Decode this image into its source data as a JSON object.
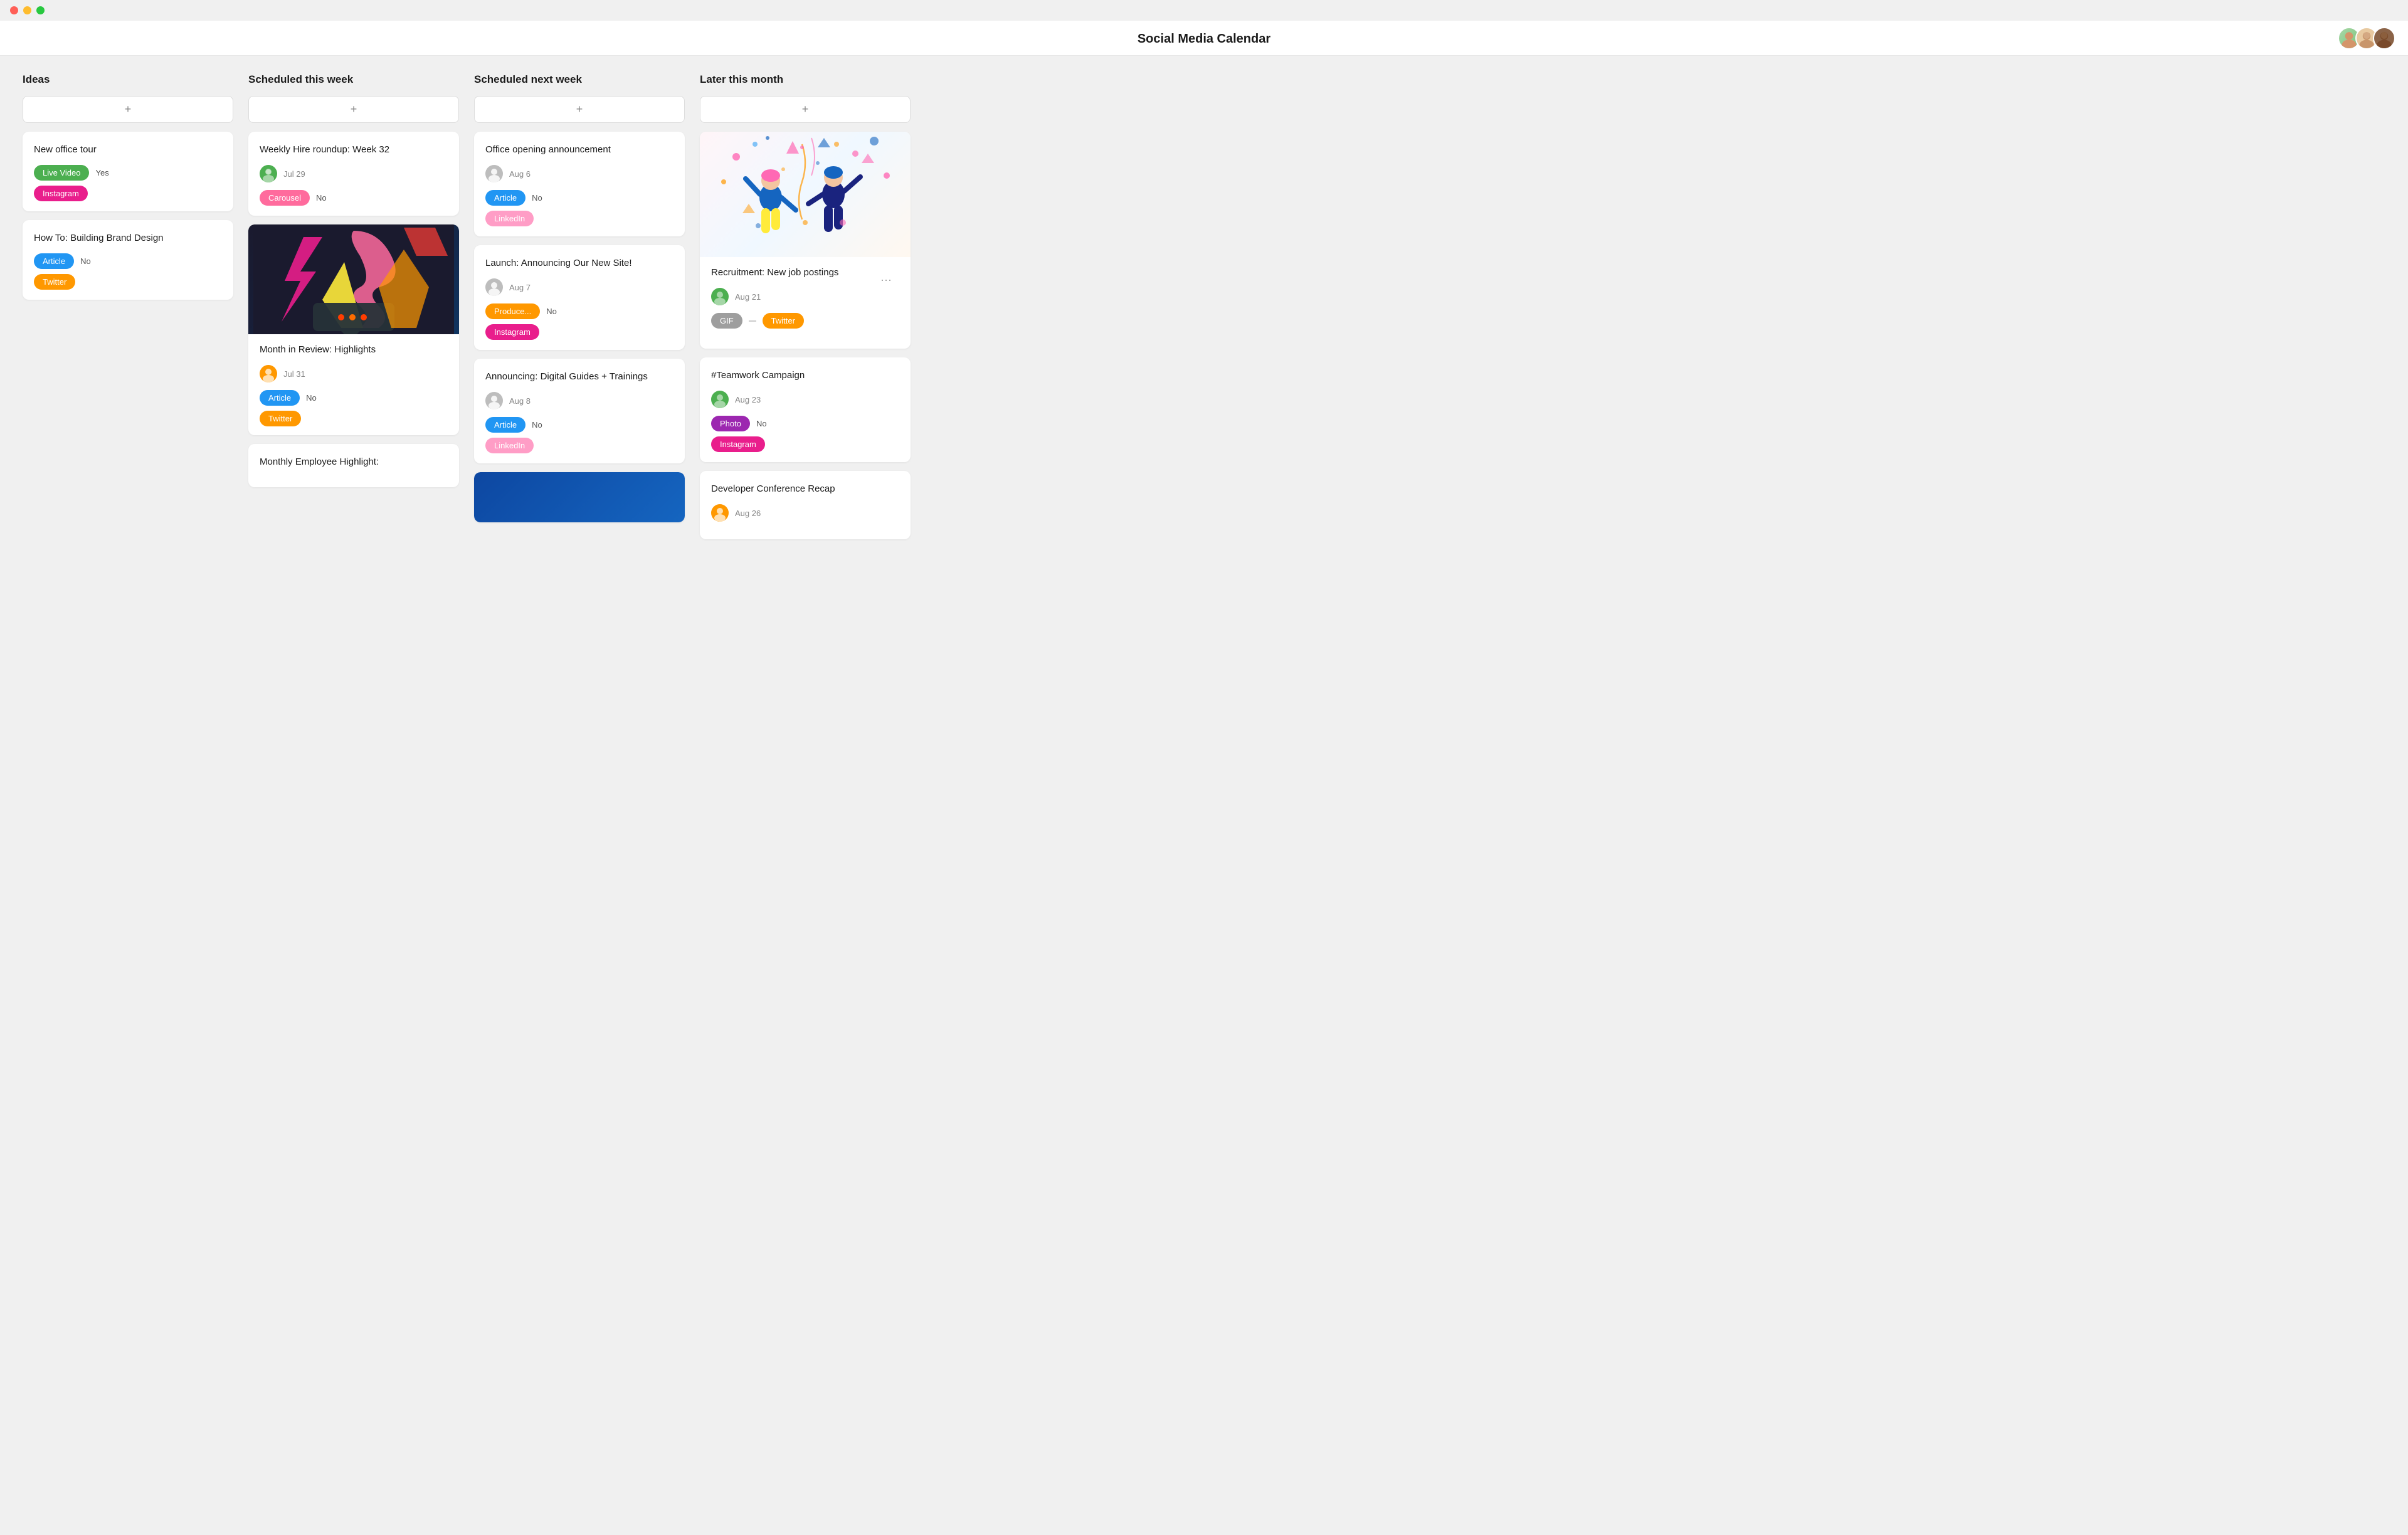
{
  "app": {
    "title": "Social Media Calendar",
    "avatars": [
      {
        "id": "avatar-1",
        "color": "#7cb9e0",
        "initials": ""
      },
      {
        "id": "avatar-2",
        "color": "#90ee90",
        "initials": ""
      },
      {
        "id": "avatar-3",
        "color": "#b8732a",
        "initials": ""
      }
    ]
  },
  "columns": [
    {
      "id": "ideas",
      "label": "Ideas",
      "add_label": "+",
      "cards": [
        {
          "id": "new-office-tour",
          "title": "New office tour",
          "tags": [
            {
              "label": "Live Video",
              "class": "tag-live-video"
            },
            {
              "label": "Instagram",
              "class": "tag-instagram"
            }
          ],
          "value": "Yes",
          "has_avatar": false
        },
        {
          "id": "brand-design",
          "title": "How To: Building Brand Design",
          "tags": [
            {
              "label": "Article",
              "class": "tag-article"
            },
            {
              "label": "Twitter",
              "class": "tag-twitter"
            }
          ],
          "value": "No",
          "has_avatar": false
        }
      ]
    },
    {
      "id": "scheduled-this-week",
      "label": "Scheduled this week",
      "add_label": "+",
      "cards": [
        {
          "id": "weekly-hire",
          "title": "Weekly Hire roundup: Week 32",
          "avatar_color": "#4CAF50",
          "date": "Jul 29",
          "tags": [
            {
              "label": "Carousel",
              "class": "tag-carousel"
            }
          ],
          "value": "No",
          "has_image": false
        },
        {
          "id": "month-review",
          "title": "Month in Review: Highlights",
          "avatar_color": "#FF9800",
          "date": "Jul 31",
          "tags": [
            {
              "label": "Article",
              "class": "tag-article"
            },
            {
              "label": "Twitter",
              "class": "tag-twitter"
            }
          ],
          "value": "No",
          "has_image": true,
          "image_type": "art"
        },
        {
          "id": "monthly-employee",
          "title": "Monthly Employee Highlight:",
          "has_image": false,
          "partial": true
        }
      ]
    },
    {
      "id": "scheduled-next-week",
      "label": "Scheduled next week",
      "add_label": "+",
      "cards": [
        {
          "id": "office-opening",
          "title": "Office opening announcement",
          "avatar_color": "#9E9E9E",
          "date": "Aug 6",
          "tags": [
            {
              "label": "Article",
              "class": "tag-article"
            },
            {
              "label": "LinkedIn",
              "class": "tag-linkedin"
            }
          ],
          "value": "No"
        },
        {
          "id": "new-site",
          "title": "Launch: Announcing Our New Site!",
          "avatar_color": "#9E9E9E",
          "date": "Aug 7",
          "tags": [
            {
              "label": "Produce...",
              "class": "tag-produce"
            },
            {
              "label": "Instagram",
              "class": "tag-instagram"
            }
          ],
          "value": "No"
        },
        {
          "id": "digital-guides",
          "title": "Announcing: Digital Guides + Trainings",
          "avatar_color": "#9E9E9E",
          "date": "Aug 8",
          "tags": [
            {
              "label": "Article",
              "class": "tag-article"
            },
            {
              "label": "LinkedIn",
              "class": "tag-linkedin"
            }
          ],
          "value": "No",
          "has_image": false
        }
      ]
    },
    {
      "id": "later-this-month",
      "label": "Later this month",
      "add_label": "+",
      "cards": [
        {
          "id": "recruitment",
          "title": "Recruitment: New job postings",
          "avatar_color": "#4CAF50",
          "date": "Aug 21",
          "tags": [
            {
              "label": "GIF",
              "class": "tag-gif"
            },
            {
              "label": "Twitter",
              "class": "tag-twitter"
            }
          ],
          "has_celebration": true
        },
        {
          "id": "teamwork",
          "title": "#Teamwork Campaign",
          "avatar_color": "#4CAF50",
          "date": "Aug 23",
          "tags": [
            {
              "label": "Photo",
              "class": "tag-photo"
            },
            {
              "label": "Instagram",
              "class": "tag-instagram"
            }
          ],
          "value": "No"
        },
        {
          "id": "dev-conference",
          "title": "Developer Conference Recap",
          "avatar_color": "#FF9800",
          "date": "Aug 26",
          "partial": true
        }
      ]
    }
  ]
}
